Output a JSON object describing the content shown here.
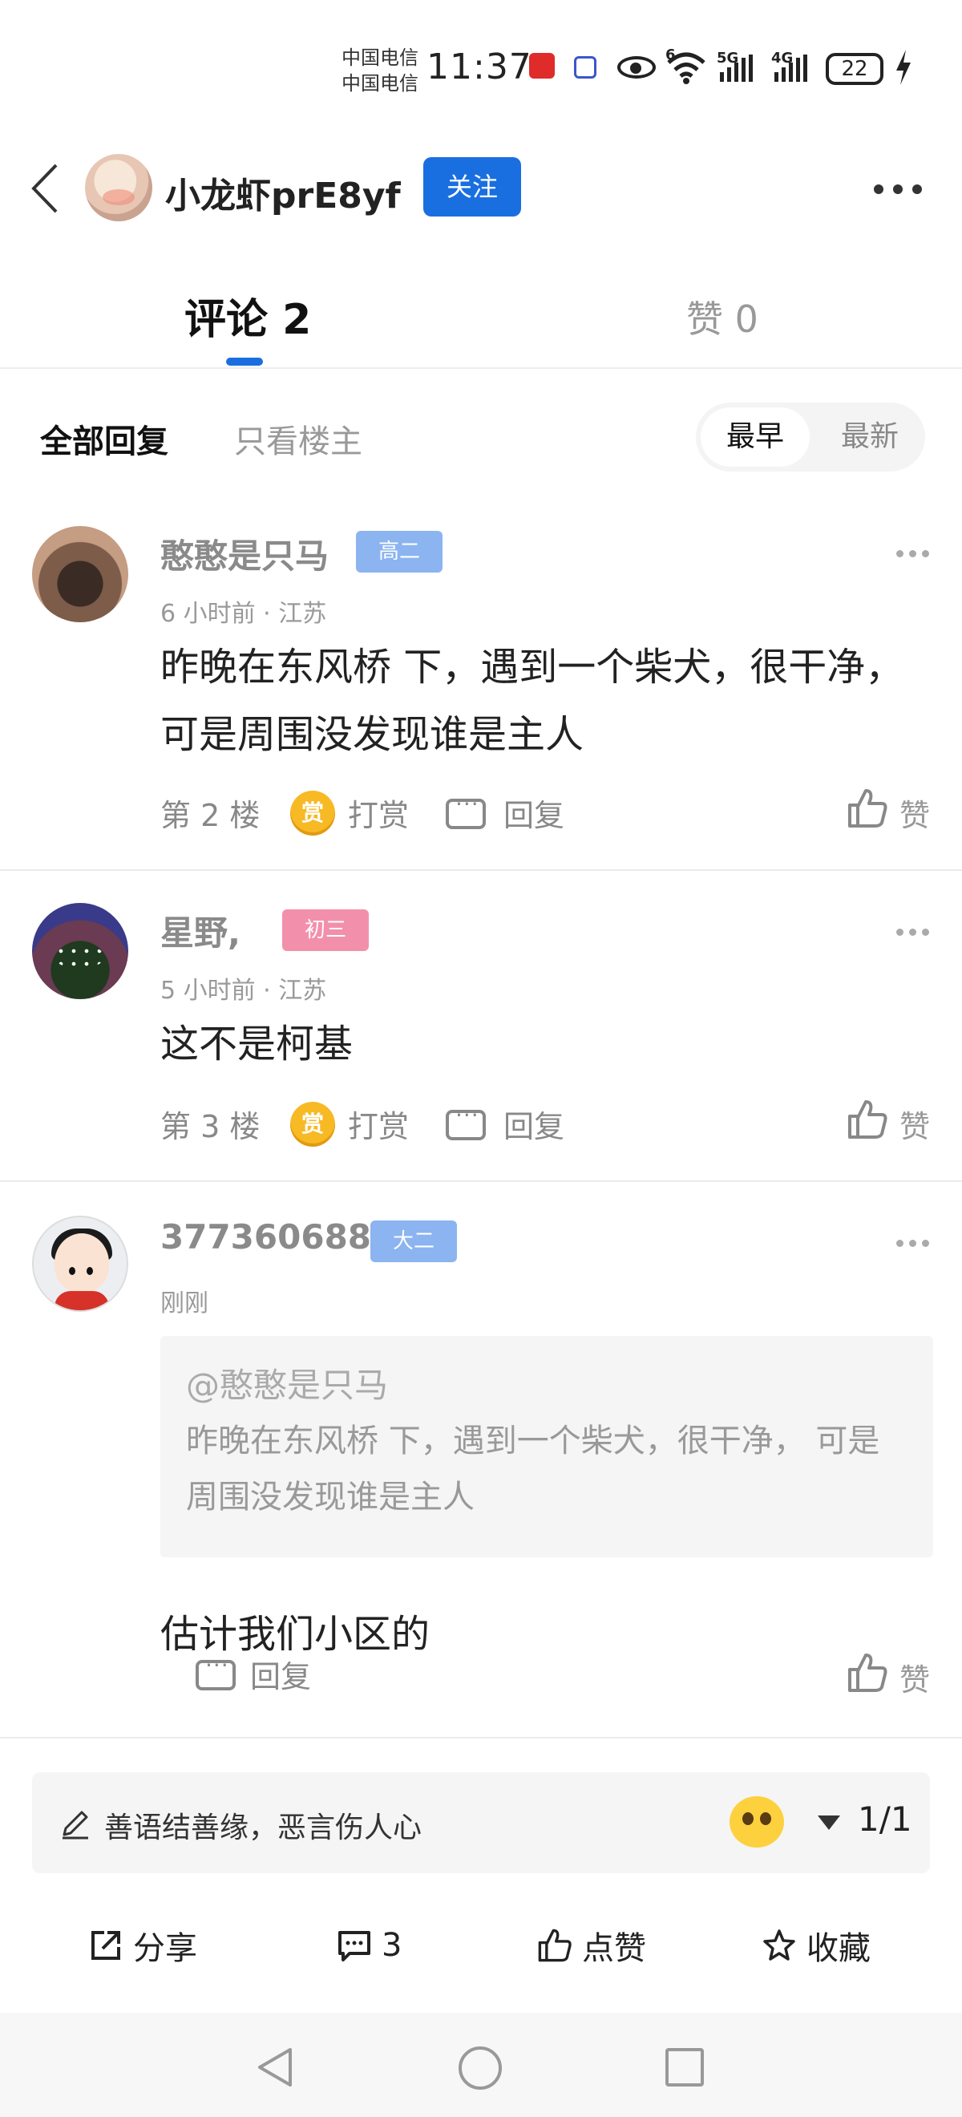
{
  "status_bar": {
    "carrier_1": "中国电信",
    "carrier_2": "中国电信",
    "time": "11:37",
    "network_6g": "6",
    "network_5g": "5G",
    "network_4g": "4G",
    "battery": "22",
    "icons": [
      "app-badge-red",
      "app-badge-blue",
      "eye-icon",
      "wifi-icon",
      "signal-icon",
      "signal-icon",
      "battery-icon",
      "charging-icon"
    ]
  },
  "header": {
    "username": "小龙虾prE8yf",
    "follow_label": "关注",
    "icons": [
      "back-icon",
      "more-icon"
    ]
  },
  "tabs": {
    "comments": "评论 2",
    "likes": "赞 0"
  },
  "filters": {
    "all": "全部回复",
    "op_only": "只看楼主",
    "sort_early": "最早",
    "sort_new": "最新"
  },
  "comments": [
    {
      "user": "憨憨是只马",
      "badge": "高二",
      "meta": "6 小时前 · 江苏",
      "text": "昨晚在东风桥 下，遇到一个柴犬，很干净， 可是周围没发现谁是主人",
      "floor": "第 2 楼",
      "tip_coin": "赏",
      "tip": "打赏",
      "reply": "回复",
      "like": "赞"
    },
    {
      "user": "星野,",
      "badge": "初三",
      "meta": "5 小时前 · 江苏",
      "text": "这不是柯基",
      "floor": "第 3 楼",
      "tip_coin": "赏",
      "tip": "打赏",
      "reply": "回复",
      "like": "赞"
    },
    {
      "user": "377360688",
      "badge": "大二",
      "meta": "刚刚",
      "quote_user": "@憨憨是只马",
      "quote_text": "昨晚在东风桥 下，遇到一个柴犬，很干净， 可是周围没发现谁是主人",
      "text": "估计我们小区的",
      "reply": "回复",
      "like": "赞"
    }
  ],
  "input_bar": {
    "placeholder": "善语结善缘，恶言伤人心",
    "page": "1/1",
    "icons": [
      "pencil-icon",
      "emoji-icon",
      "triangle-down-icon"
    ]
  },
  "actions": {
    "share": "分享",
    "comments": "3",
    "like": "点赞",
    "favorite": "收藏"
  },
  "colors": {
    "accent": "#1a6fe0",
    "badge_blue": "#8bb4f0",
    "badge_pink": "#f290ac",
    "coin": "#f7b924"
  }
}
